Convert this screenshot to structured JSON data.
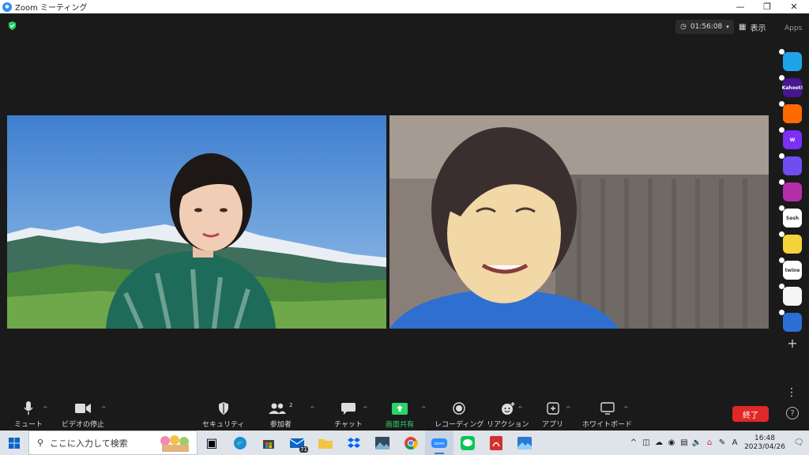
{
  "window": {
    "title": "Zoom ミーティング"
  },
  "meeting": {
    "timer": "01:56:08",
    "view_label": "表示",
    "apps_label": "Apps"
  },
  "apps": [
    {
      "name": "app-1",
      "label": "",
      "color": "#1fa3e8"
    },
    {
      "name": "kahoot",
      "label": "Kahoot!",
      "color": "#46178f"
    },
    {
      "name": "app-3",
      "label": "",
      "color": "#ff6a00"
    },
    {
      "name": "app-4",
      "label": "W",
      "color": "#7b2ff7"
    },
    {
      "name": "app-5",
      "label": "",
      "color": "#6f4df0"
    },
    {
      "name": "app-6",
      "label": "",
      "color": "#b32fa8"
    },
    {
      "name": "sesh",
      "label": "Sesh",
      "color": "#ffffff"
    },
    {
      "name": "app-8",
      "label": "",
      "color": "#f4d33a"
    },
    {
      "name": "twine",
      "label": "twine",
      "color": "#ffffff"
    },
    {
      "name": "app-10",
      "label": "",
      "color": "#f5f5f5"
    },
    {
      "name": "app-11",
      "label": "",
      "color": "#2b6fd6"
    }
  ],
  "toolbar": {
    "mute": "ミュート",
    "video": "ビデオの停止",
    "security": "セキュリティ",
    "participants": "参加者",
    "participants_count": "2",
    "chat": "チャット",
    "share": "画面共有",
    "record": "レコーディング",
    "reactions": "リアクション",
    "apps": "アプリ",
    "whiteboard": "ホワイトボード",
    "end": "終了"
  },
  "taskbar": {
    "search_placeholder": "ここに入力して検索",
    "badge": "71",
    "time": "16:48",
    "date": "2023/04/26",
    "ime": "A"
  },
  "colors": {
    "share_green": "#2bd46b",
    "end_red": "#e02828",
    "accent_blue": "#2d8cff"
  }
}
